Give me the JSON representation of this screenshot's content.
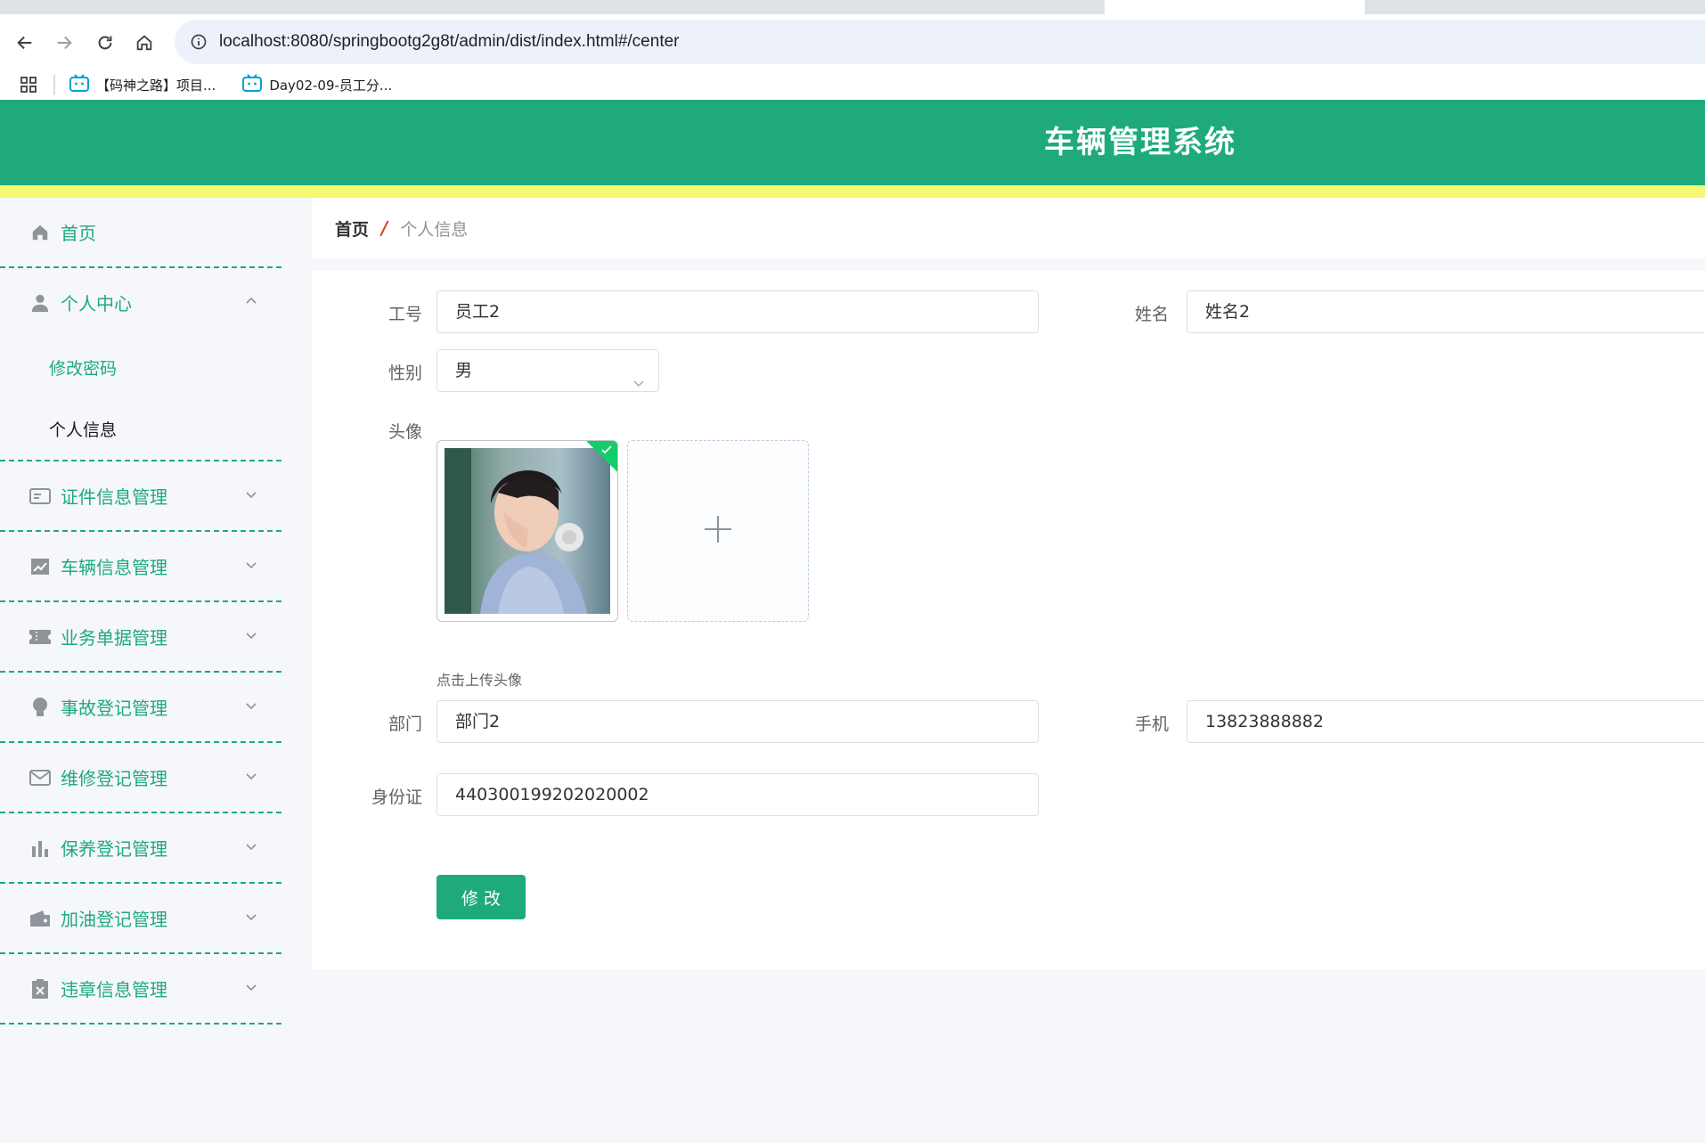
{
  "browser": {
    "url": "localhost:8080/springbootg2g8t/admin/dist/index.html#/center",
    "bookmarks": [
      {
        "label": "【码神之路】项目..."
      },
      {
        "label": "Day02-09-员工分..."
      }
    ]
  },
  "header": {
    "title": "车辆管理系统"
  },
  "colors": {
    "primary": "#1eaa7c",
    "accent_bar": "#f5f872",
    "breadcrumb_sep": "#e03c2c"
  },
  "sidebar": {
    "home": {
      "label": "首页",
      "icon": "home-icon"
    },
    "personal": {
      "label": "个人中心",
      "icon": "user-icon",
      "children": [
        {
          "label": "修改密码"
        },
        {
          "label": "个人信息"
        }
      ]
    },
    "items": [
      {
        "label": "证件信息管理",
        "icon": "id-card-icon"
      },
      {
        "label": "车辆信息管理",
        "icon": "chart-icon"
      },
      {
        "label": "业务单据管理",
        "icon": "ticket-icon"
      },
      {
        "label": "事故登记管理",
        "icon": "bulb-icon"
      },
      {
        "label": "维修登记管理",
        "icon": "mail-icon"
      },
      {
        "label": "保养登记管理",
        "icon": "bar-chart-icon"
      },
      {
        "label": "加油登记管理",
        "icon": "wallet-icon"
      },
      {
        "label": "违章信息管理",
        "icon": "clipboard-x-icon"
      }
    ]
  },
  "breadcrumb": {
    "home": "首页",
    "separator": "/",
    "current": "个人信息"
  },
  "form": {
    "employee_no": {
      "label": "工号",
      "value": "员工2"
    },
    "name": {
      "label": "姓名",
      "value": "姓名2"
    },
    "gender": {
      "label": "性别",
      "value": "男"
    },
    "avatar": {
      "label": "头像",
      "tip": "点击上传头像"
    },
    "department": {
      "label": "部门",
      "value": "部门2"
    },
    "phone": {
      "label": "手机",
      "value": "13823888882"
    },
    "id_card": {
      "label": "身份证",
      "value": "440300199202020002"
    },
    "submit_label": "修改"
  }
}
